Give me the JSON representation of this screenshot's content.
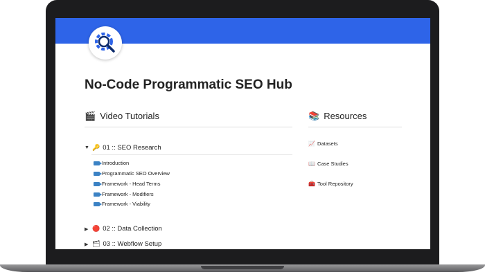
{
  "page": {
    "title": "No-Code Programmatic SEO Hub",
    "banner_color": "#2e64e8",
    "logo_icon": "gear-magnifier-icon"
  },
  "video_tutorials": {
    "heading": "Video Tutorials",
    "icon": "🎬",
    "sections": [
      {
        "label": "01 :: SEO Research",
        "icon": "🔑",
        "expanded": true,
        "items": [
          "Introduction",
          "Programmatic SEO Overview",
          "Framework - Head Terms",
          "Framework - Modifiers",
          "Framework - Viability"
        ]
      },
      {
        "label": "02 :: Data Collection",
        "icon": "🔴",
        "expanded": false
      },
      {
        "label": "03 :: Webflow Setup",
        "icon": "🗂",
        "expanded": false
      }
    ]
  },
  "resources": {
    "heading": "Resources",
    "icon": "📚",
    "items": [
      {
        "label": "Datasets",
        "icon": "📈"
      },
      {
        "label": "Case Studies",
        "icon": "📖"
      },
      {
        "label": "Tool Repository",
        "icon": "🧰"
      }
    ]
  }
}
